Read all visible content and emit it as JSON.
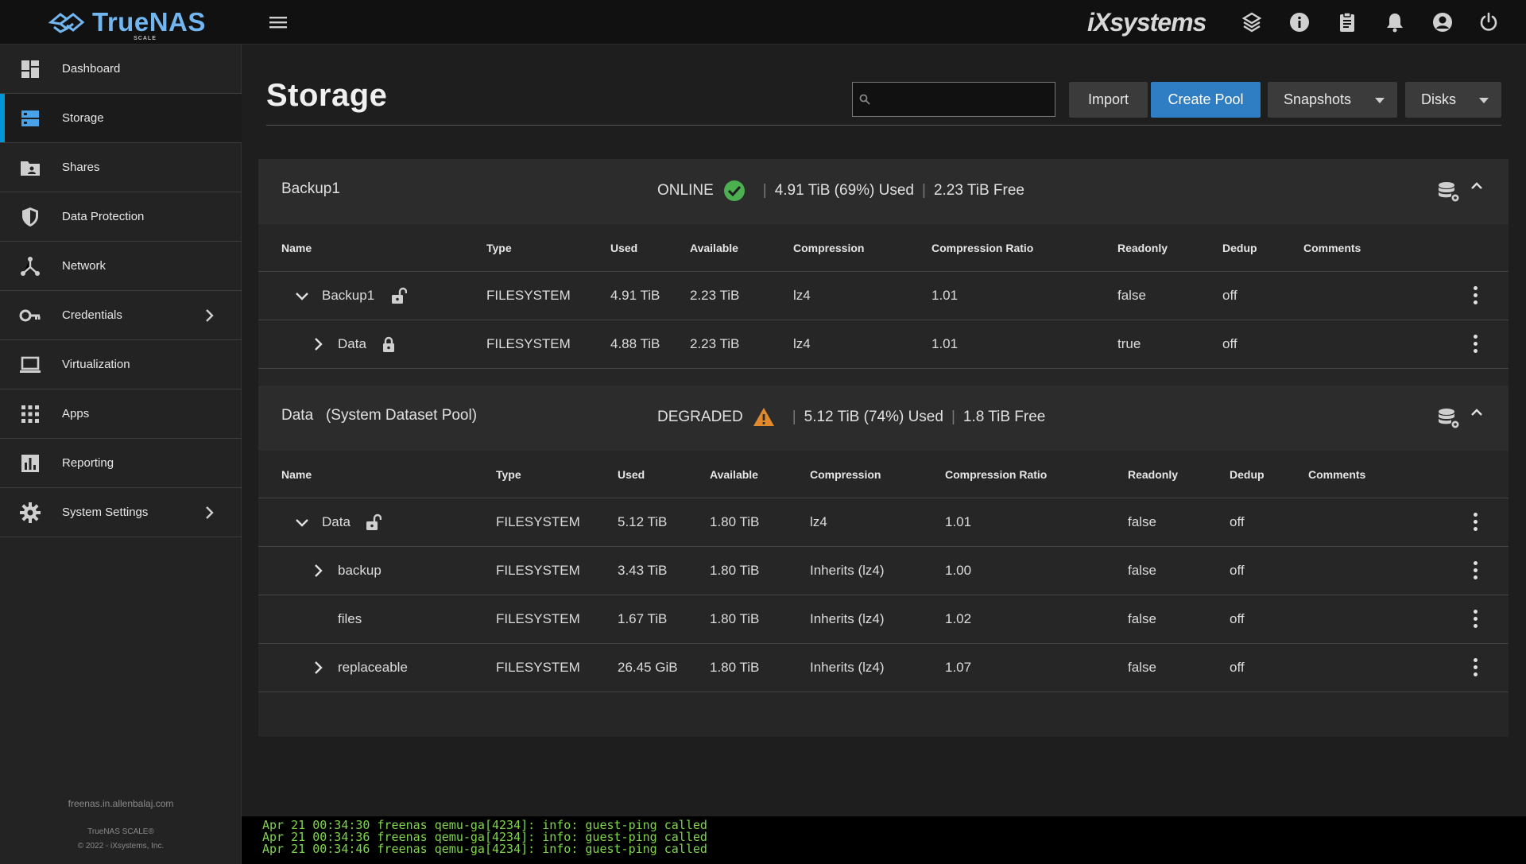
{
  "app": {
    "logo_text": "TrueNAS",
    "logo_sub": "SCALE",
    "vendor_logo": "iXsystems"
  },
  "topbar": {
    "icons": [
      "menu-icon",
      "truecommand-icon",
      "info-icon",
      "clipboard-icon",
      "bell-icon",
      "account-circle-icon",
      "power-icon"
    ]
  },
  "sidebar": {
    "items": [
      {
        "label": "Dashboard",
        "icon": "dashboard-icon"
      },
      {
        "label": "Storage",
        "icon": "storage-icon",
        "active": true
      },
      {
        "label": "Shares",
        "icon": "shares-folder-icon"
      },
      {
        "label": "Data Protection",
        "icon": "shield-icon"
      },
      {
        "label": "Network",
        "icon": "network-icon"
      },
      {
        "label": "Credentials",
        "icon": "key-icon",
        "has_submenu": true
      },
      {
        "label": "Virtualization",
        "icon": "laptop-icon"
      },
      {
        "label": "Apps",
        "icon": "apps-grid-icon"
      },
      {
        "label": "Reporting",
        "icon": "bar-chart-icon"
      },
      {
        "label": "System Settings",
        "icon": "gear-icon",
        "has_submenu": true
      }
    ],
    "hostname": "freenas.in.allenbalaj.com",
    "version": "TrueNAS SCALE®",
    "copyright": "© 2022 - iXsystems, Inc."
  },
  "page": {
    "title": "Storage",
    "search": {
      "value": "",
      "placeholder": ""
    },
    "buttons": {
      "import": "Import",
      "create_pool": "Create Pool",
      "snapshots": "Snapshots",
      "disks": "Disks"
    }
  },
  "colors": {
    "accent": "#2f7ec4",
    "active_indicator": "#0095d5",
    "online": "#4caf50",
    "degraded": "#e08a2c",
    "console_text": "#7fd64a"
  },
  "pools": [
    {
      "name": "Backup1",
      "status": "ONLINE",
      "status_icon": "check-circle-icon",
      "used": "4.91 TiB (69%) Used",
      "free": "2.23 TiB Free",
      "columns": [
        "Name",
        "Type",
        "Used",
        "Available",
        "Compression",
        "Compression Ratio",
        "Readonly",
        "Dedup",
        "Comments"
      ],
      "rows": [
        {
          "name": "Backup1",
          "expand": "down",
          "lock": "unlocked",
          "type": "FILESYSTEM",
          "used": "4.91 TiB",
          "available": "2.23 TiB",
          "compression": "lz4",
          "ratio": "1.01",
          "readonly": "false",
          "dedup": "off",
          "comments": ""
        },
        {
          "name": "Data",
          "expand": "right",
          "lock": "locked",
          "type": "FILESYSTEM",
          "used": "4.88 TiB",
          "available": "2.23 TiB",
          "compression": "lz4",
          "ratio": "1.01",
          "readonly": "true",
          "dedup": "off",
          "comments": ""
        }
      ]
    },
    {
      "name": "Data",
      "subtitle": "(System Dataset Pool)",
      "status": "DEGRADED",
      "status_icon": "warning-triangle-icon",
      "used": "5.12 TiB (74%) Used",
      "free": "1.8 TiB Free",
      "columns": [
        "Name",
        "Type",
        "Used",
        "Available",
        "Compression",
        "Compression Ratio",
        "Readonly",
        "Dedup",
        "Comments"
      ],
      "rows": [
        {
          "name": "Data",
          "expand": "down",
          "lock": "unlocked",
          "type": "FILESYSTEM",
          "used": "5.12 TiB",
          "available": "1.80 TiB",
          "compression": "lz4",
          "ratio": "1.01",
          "readonly": "false",
          "dedup": "off",
          "comments": ""
        },
        {
          "name": "backup",
          "expand": "right",
          "type": "FILESYSTEM",
          "used": "3.43 TiB",
          "available": "1.80 TiB",
          "compression": "Inherits (lz4)",
          "ratio": "1.00",
          "readonly": "false",
          "dedup": "off",
          "comments": ""
        },
        {
          "name": "files",
          "expand": "none",
          "type": "FILESYSTEM",
          "used": "1.67 TiB",
          "available": "1.80 TiB",
          "compression": "Inherits (lz4)",
          "ratio": "1.02",
          "readonly": "false",
          "dedup": "off",
          "comments": ""
        },
        {
          "name": "replaceable",
          "expand": "right",
          "type": "FILESYSTEM",
          "used": "26.45 GiB",
          "available": "1.80 TiB",
          "compression": "Inherits (lz4)",
          "ratio": "1.07",
          "readonly": "false",
          "dedup": "off",
          "comments": ""
        }
      ]
    }
  ],
  "console": {
    "lines": [
      "Apr 21 00:34:30 freenas qemu-ga[4234]: info: guest-ping called",
      "Apr 21 00:34:36 freenas qemu-ga[4234]: info: guest-ping called",
      "Apr 21 00:34:46 freenas qemu-ga[4234]: info: guest-ping called"
    ]
  }
}
